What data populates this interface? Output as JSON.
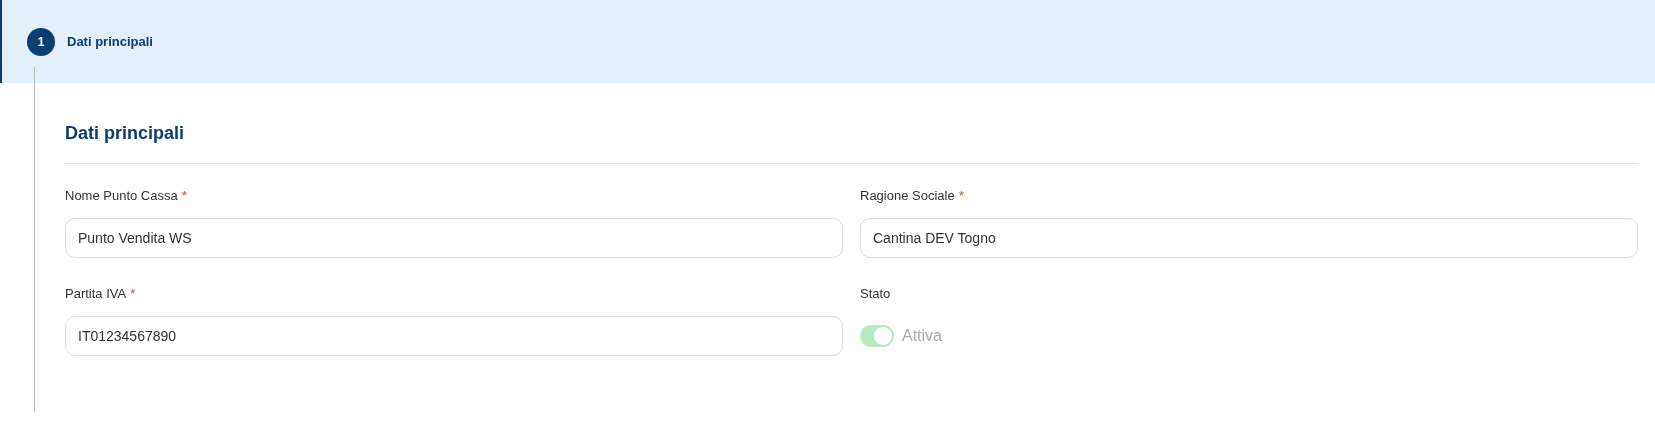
{
  "step": {
    "number": "1",
    "label": "Dati principali",
    "selected": true
  },
  "section": {
    "title": "Dati principali"
  },
  "fields": [
    {
      "kind": "text",
      "label": "Nome Punto Cassa",
      "required_mark": "*",
      "value": "Punto Vendita WS"
    },
    {
      "kind": "text",
      "label": "Ragione Sociale",
      "required_mark": "*",
      "value": "Cantina DEV Togno"
    },
    {
      "kind": "text",
      "label": "Partita IVA",
      "required_mark": "*",
      "value": "IT01234567890"
    },
    {
      "kind": "toggle",
      "label": "Stato",
      "on": true,
      "disabled": true,
      "text": "Attiva"
    }
  ]
}
